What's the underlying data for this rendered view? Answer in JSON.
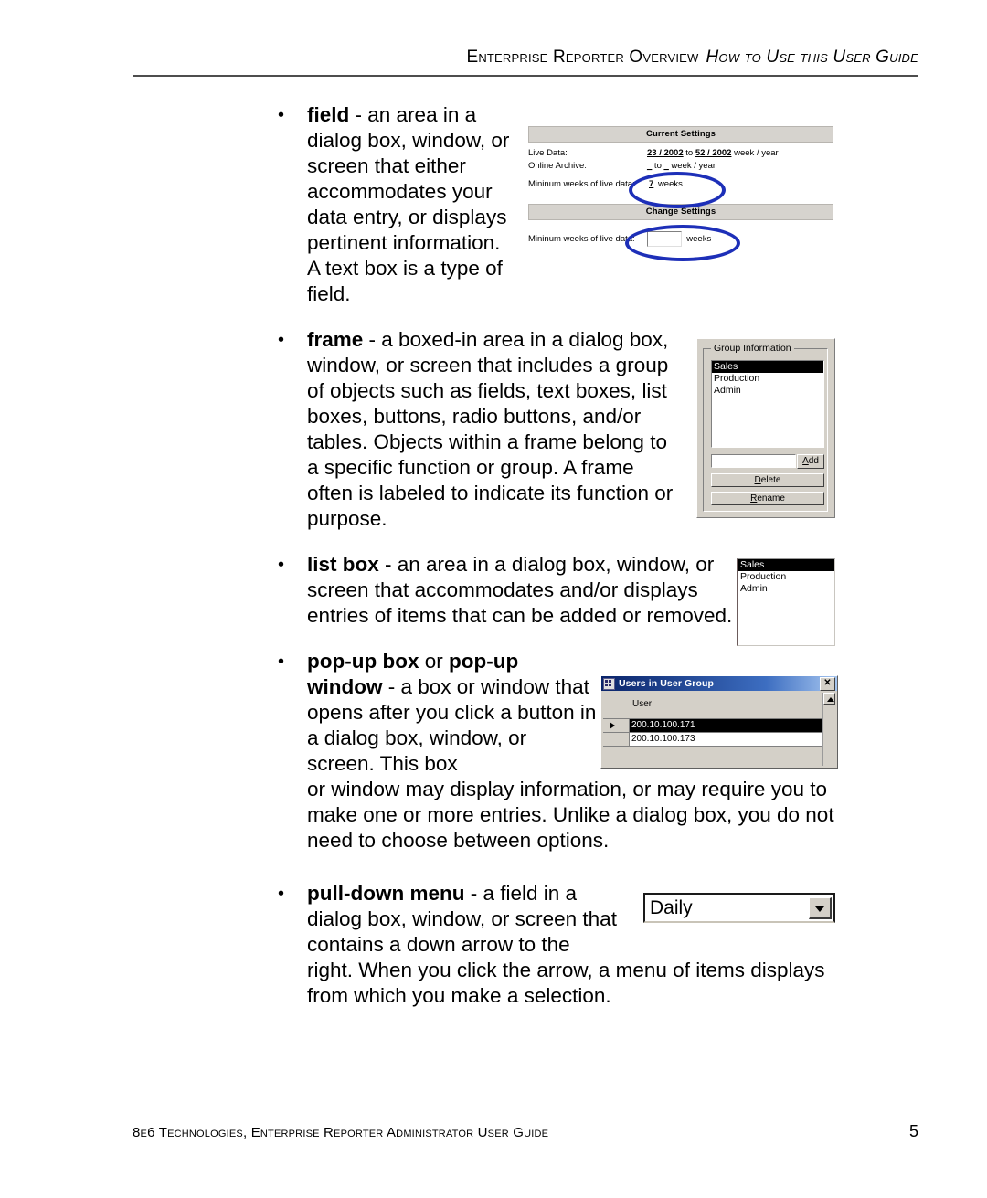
{
  "header": {
    "main": "Enterprise Reporter Overview",
    "italic": "How to Use this User Guide"
  },
  "bullets": [
    {
      "term": "field",
      "dash": " - ",
      "text": "an area in a dialog box, window, or screen that either accommodates your data entry, or displays pertinent information. A text box is a type of field."
    },
    {
      "term": "frame",
      "dash": " - ",
      "text": "a boxed-in area in a dialog box, window, or screen that includes a group of objects such as fields, text boxes, list boxes, buttons, radio buttons, and/or tables. Objects within a frame belong to a specific function or group. A frame often is labeled to indicate its function or purpose."
    },
    {
      "term": "list box",
      "dash": " - ",
      "text": "an area in a dialog box, window, or screen that accommodates and/or displays entries of items that can be added or removed."
    },
    {
      "term": "pop-up box",
      "conjunction": " or ",
      "term2": "pop-up window",
      "dash": " - ",
      "text": "a box or window that opens after you click a button in a dialog box, window, or screen. This box",
      "tail": "or window may display information, or may require you to make one or more entries. Unlike a dialog box, you do not need to choose between options."
    },
    {
      "term": "pull-down menu",
      "dash": " - ",
      "text": "a field in a dialog box, window, or screen that contains a down arrow to the",
      "tail": "right. When you click the arrow, a menu of items displays from which you make a selection."
    }
  ],
  "bullet_glyph": "•",
  "figures": {
    "settings": {
      "current_header": "Current Settings",
      "change_header": "Change Settings",
      "rows": [
        {
          "label": "Live Data:",
          "value_a": "23 / 2002",
          "to": " to ",
          "value_b": "52 / 2002",
          "unit": " week / year"
        },
        {
          "label": "Online Archive:",
          "value_a": "_",
          "to": " to ",
          "value_b": "_",
          "unit": " week / year"
        }
      ],
      "min_weeks_label": "Mininum weeks of live data:",
      "min_weeks_value": "7",
      "weeks_unit": "weeks",
      "change_min_weeks_label": "Mininum weeks of live data:",
      "change_weeks_unit": "weeks",
      "annotation_color": "#1d2fb8"
    },
    "group_frame": {
      "title": "Group Information",
      "items": [
        "Sales",
        "Production",
        "Admin"
      ],
      "selected_index": 0,
      "input_value": "",
      "buttons": {
        "add": {
          "accel": "A",
          "rest": "dd"
        },
        "delete": {
          "accel": "D",
          "rest": "elete"
        },
        "rename": {
          "accel": "R",
          "rest": "ename"
        }
      }
    },
    "list_box": {
      "items": [
        "Sales",
        "Production",
        "Admin"
      ],
      "selected_index": 0
    },
    "popup": {
      "title": "Users in User Group",
      "close_label": "✕",
      "column_header": "User",
      "rows": [
        {
          "value": "200.10.100.171",
          "selected": true,
          "current": true
        },
        {
          "value": "200.10.100.173",
          "selected": false,
          "current": false
        }
      ]
    },
    "pulldown": {
      "value": "Daily"
    }
  },
  "footer": {
    "text": "8e6 Technologies, Enterprise Reporter Administrator User Guide",
    "page": "5"
  }
}
